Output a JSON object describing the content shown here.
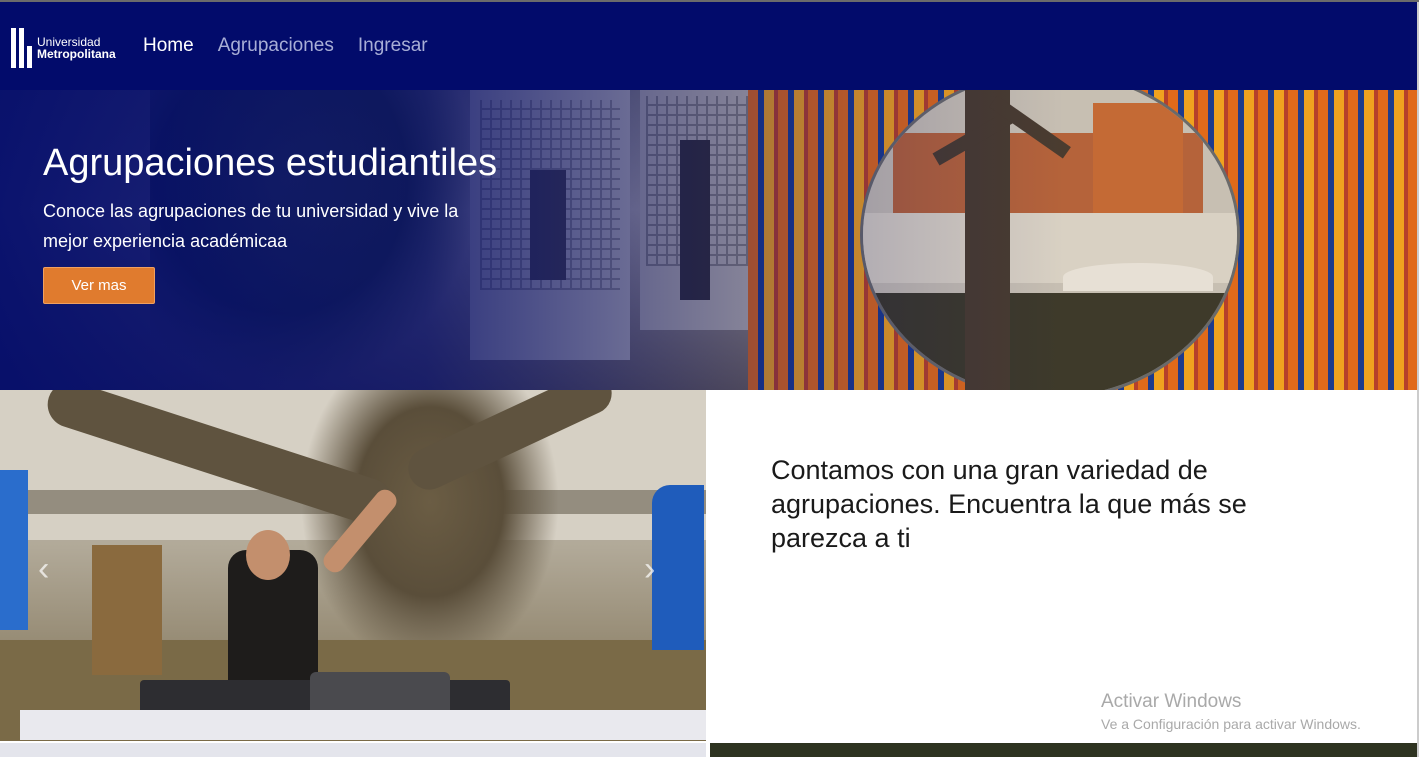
{
  "navbar": {
    "logo": {
      "line1": "Universidad",
      "line2": "Metropolitana"
    },
    "links": [
      {
        "label": "Home",
        "active": true
      },
      {
        "label": "Agrupaciones",
        "active": false
      },
      {
        "label": "Ingresar",
        "active": false
      }
    ],
    "background_color": "#020b6b"
  },
  "hero": {
    "title": "Agrupaciones estudiantiles",
    "subtitle": "Conoce las agrupaciones de tu universidad y vive la mejor experiencia académicaa",
    "button_label": "Ver mas",
    "button_color": "#e07b2e"
  },
  "carousel": {
    "prev_icon": "chevron-left-icon",
    "next_icon": "chevron-right-icon"
  },
  "info": {
    "text": "Contamos con una gran variedad de agrupaciones. Encuentra la que más se parezca a ti"
  },
  "watermark": {
    "line1": "Activar Windows",
    "line2": "Ve a Configuración para activar Windows."
  }
}
